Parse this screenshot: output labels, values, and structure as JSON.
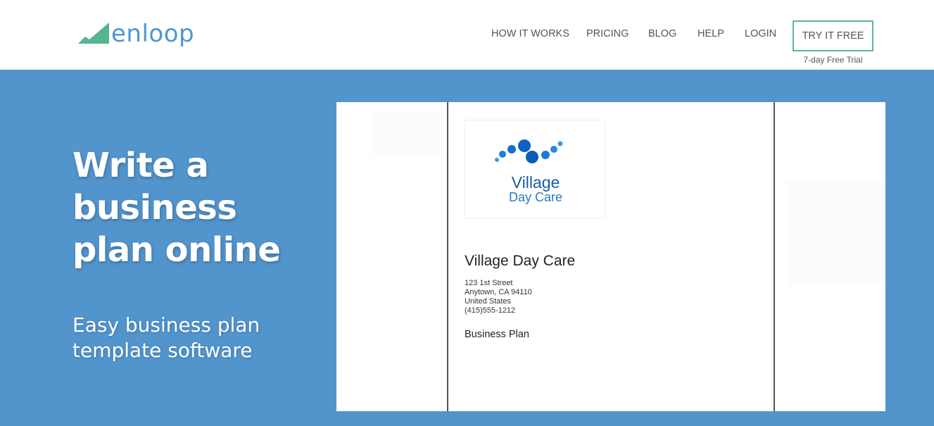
{
  "header": {
    "logo": {
      "text": "enloop",
      "mark_icon": "rising-chart-icon",
      "mark_color": "#56b48f",
      "text_color": "#4f95d3"
    },
    "nav": [
      {
        "label": "HOW IT WORKS"
      },
      {
        "label": "PRICING"
      },
      {
        "label": "BLOG"
      },
      {
        "label": "HELP"
      },
      {
        "label": "LOGIN"
      }
    ],
    "cta": {
      "label": "TRY IT FREE",
      "sublabel": "7-day Free Trial",
      "border_color": "#5bb89a"
    }
  },
  "hero": {
    "background_color": "#5294cc",
    "title": "Write a business plan online",
    "subtitle": "Easy business plan template software"
  },
  "preview": {
    "logo_box": {
      "word1": "Village",
      "word2": "Day Care",
      "icon": "dots-arc-icon"
    },
    "company_name": "Village Day Care",
    "address_lines": [
      "123 1st Street",
      "Anytown, CA 94110",
      "United States",
      "(415)555-1212"
    ],
    "doc_type": "Business Plan"
  }
}
